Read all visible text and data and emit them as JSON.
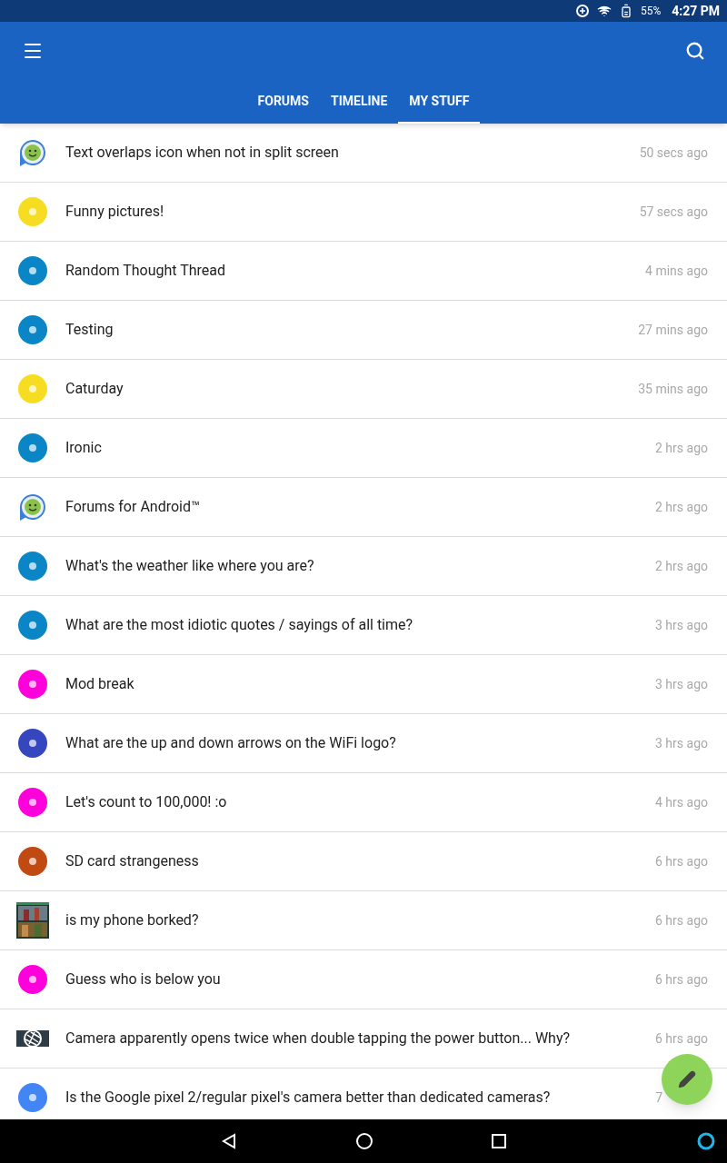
{
  "status_bar": {
    "battery": "55%",
    "time": "4:27 PM"
  },
  "tabs": [
    {
      "label": "FORUMS",
      "selected": false
    },
    {
      "label": "TIMELINE",
      "selected": false
    },
    {
      "label": "MY STUFF",
      "selected": true
    }
  ],
  "threads": [
    {
      "kind": "app-logo",
      "title": "Text overlaps icon when not in split screen",
      "time": "50 secs ago"
    },
    {
      "kind": "avatar",
      "color": "#f6dd22",
      "title": "Funny pictures!",
      "time": "57 secs ago"
    },
    {
      "kind": "avatar",
      "color": "#0a86c6",
      "title": "Random Thought Thread",
      "time": "4 mins ago"
    },
    {
      "kind": "avatar",
      "color": "#0a86c6",
      "title": "Testing",
      "time": "27 mins ago"
    },
    {
      "kind": "avatar",
      "color": "#f6dd22",
      "title": "Caturday",
      "time": "35 mins ago"
    },
    {
      "kind": "avatar",
      "color": "#0a86c6",
      "title": "Ironic",
      "time": "2 hrs ago"
    },
    {
      "kind": "app-logo",
      "title": "Forums for Android™",
      "time": "2 hrs ago"
    },
    {
      "kind": "avatar",
      "color": "#0a86c6",
      "title": "What's the weather like where you are?",
      "time": "2 hrs ago"
    },
    {
      "kind": "avatar",
      "color": "#0a86c6",
      "title": "What are the most idiotic quotes / sayings of all time?",
      "time": "3 hrs ago"
    },
    {
      "kind": "avatar",
      "color": "#ff00dd",
      "title": "Mod break",
      "time": "3 hrs ago"
    },
    {
      "kind": "avatar",
      "color": "#3546be",
      "title": "What are the up and down arrows on the WiFi logo?",
      "time": "3 hrs ago"
    },
    {
      "kind": "avatar",
      "color": "#ff00dd",
      "title": "Let's count to 100,000! :o",
      "time": "4 hrs ago"
    },
    {
      "kind": "avatar",
      "color": "#c04a12",
      "title": "SD card strangeness",
      "time": "6 hrs ago"
    },
    {
      "title": "is my phone borked?",
      "time": "6 hrs ago"
    },
    {
      "kind": "avatar",
      "color": "#ff00dd",
      "title": "Guess who is below you",
      "time": "6 hrs ago"
    },
    {
      "kind": "camera",
      "title": "Camera apparently opens twice when double tapping the power button... Why?",
      "time": "6 hrs ago"
    },
    {
      "kind": "avatar",
      "color": "#4285f4",
      "title": "Is the Google pixel 2/regular pixel's camera better than dedicated cameras?",
      "time": "7"
    }
  ]
}
